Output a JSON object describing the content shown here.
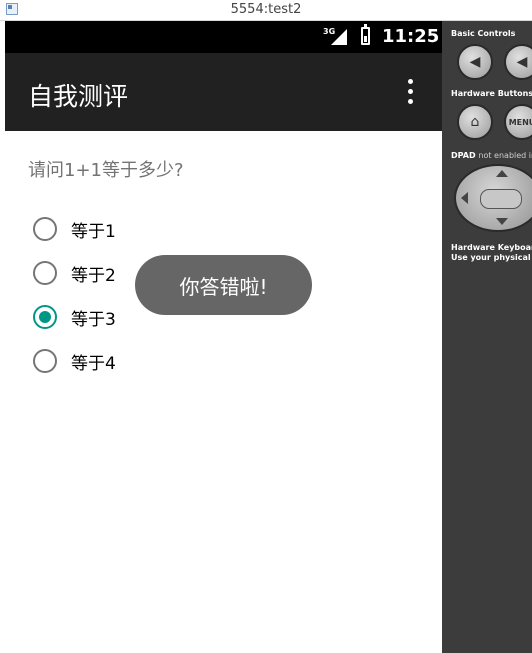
{
  "window": {
    "title": "5554:test2"
  },
  "statusbar": {
    "network": "3G",
    "time": "11:25"
  },
  "appbar": {
    "title": "自我测评"
  },
  "question": "请问1+1等于多少?",
  "options": [
    {
      "label": "等于1",
      "checked": false
    },
    {
      "label": "等于2",
      "checked": false
    },
    {
      "label": "等于3",
      "checked": true
    },
    {
      "label": "等于4",
      "checked": false
    }
  ],
  "toast": "你答错啦!",
  "panel": {
    "basic_controls": "Basic Controls",
    "hardware_buttons": "Hardware Buttons",
    "dpad_label": "DPAD",
    "dpad_status": "not enabled in",
    "keyboard_title": "Hardware Keyboard",
    "keyboard_hint": "Use your physical k",
    "menu_label": "MENU"
  },
  "colors": {
    "accent": "#009688",
    "appbar": "#212121",
    "panel": "#3c3c3c"
  }
}
